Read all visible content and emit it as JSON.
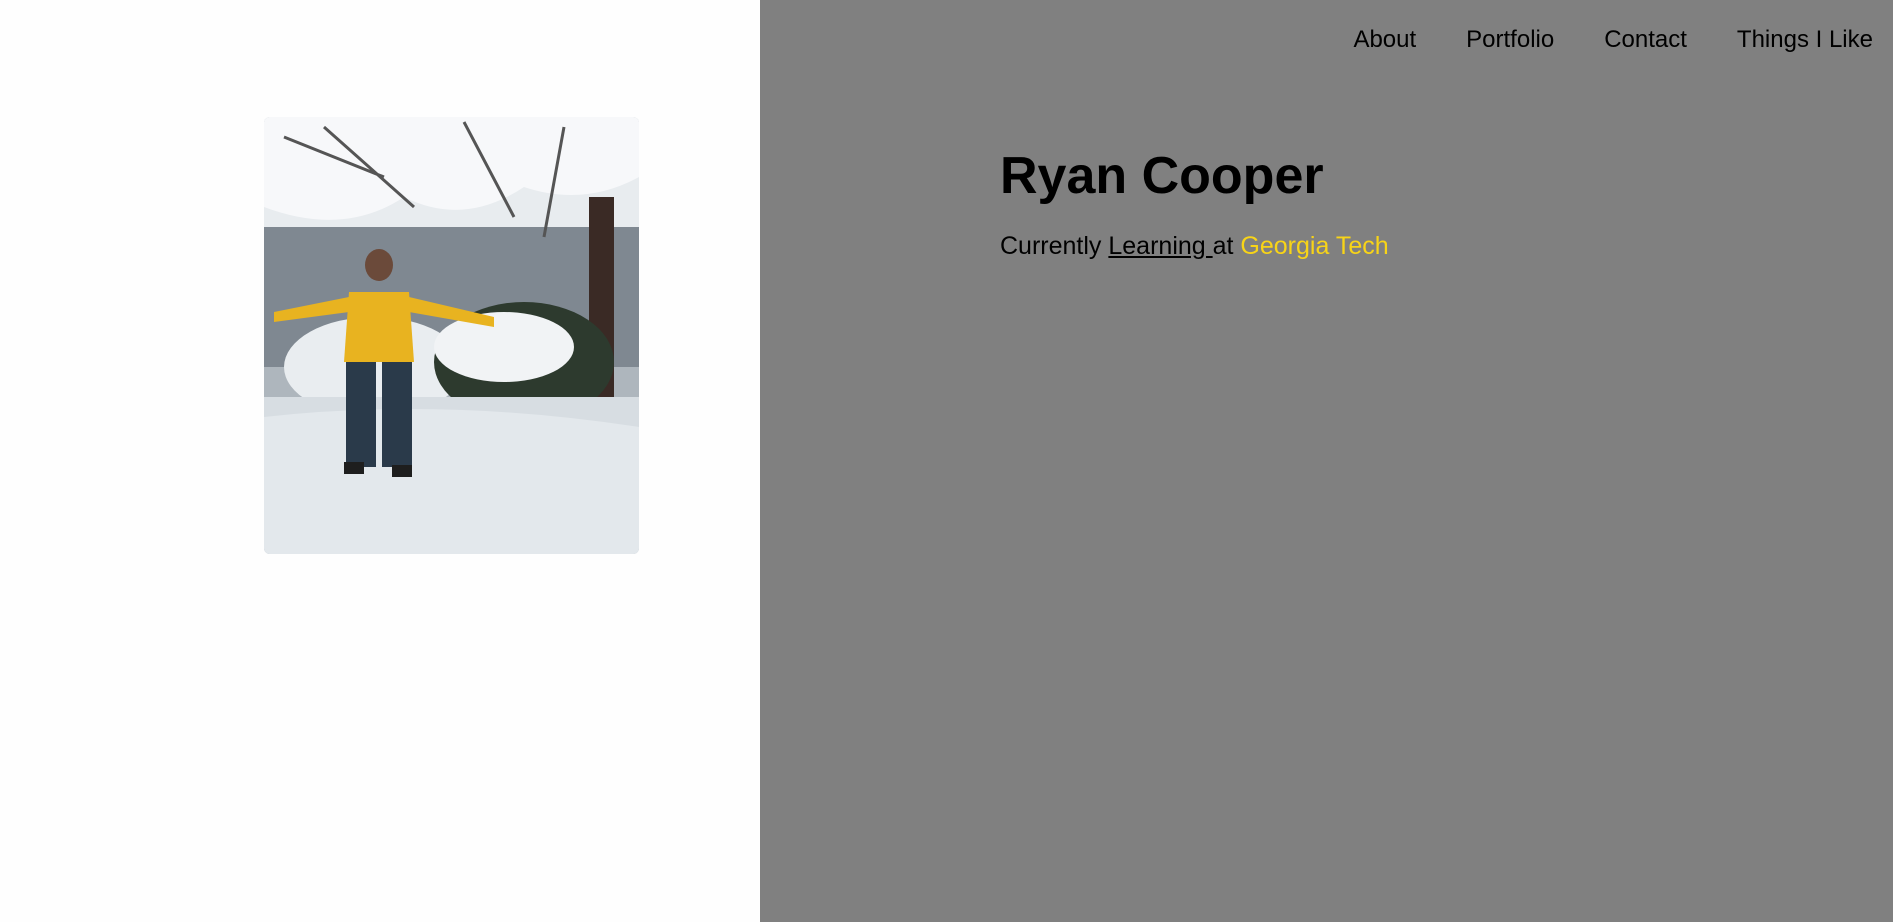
{
  "nav": {
    "items": [
      {
        "label": "About"
      },
      {
        "label": "Portfolio"
      },
      {
        "label": "Contact"
      },
      {
        "label": "Things I Like"
      }
    ]
  },
  "hero": {
    "name": "Ryan Cooper",
    "tagline_prefix": "Currently ",
    "tagline_link": "Learning ",
    "tagline_middle": "at ",
    "tagline_school": "Georgia Tech"
  },
  "photo": {
    "description_icon": "profile-photo"
  },
  "colors": {
    "right_panel_bg": "#808080",
    "left_panel_bg": "#fefefe",
    "school_accent": "#f8d417"
  }
}
